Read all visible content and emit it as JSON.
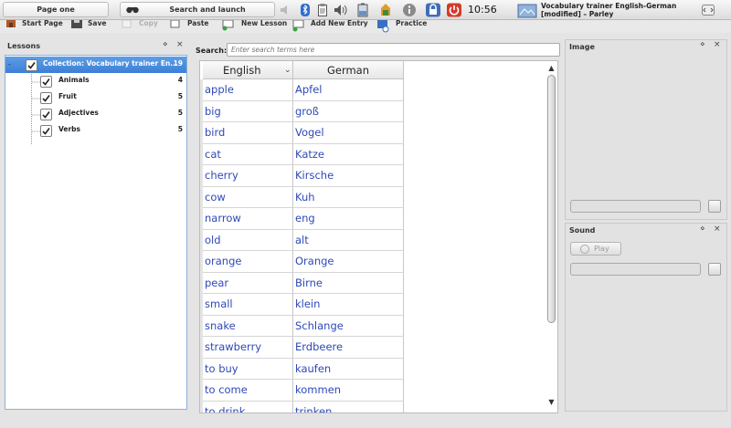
{
  "panel": {
    "pager_label": "Page one",
    "launcher_label": "Search and launch",
    "clock": "10:56 am",
    "window_title": "Vocabulary trainer English-German [modified] – Parley"
  },
  "toolbar": {
    "start_page": "Start Page",
    "save": "Save",
    "copy": "Copy",
    "paste": "Paste",
    "new_lesson": "New Lesson",
    "add_new_entry": "Add New Entry",
    "practice": "Practice"
  },
  "lessons": {
    "title": "Lessons",
    "items": [
      {
        "label": "Collection: Vocabulary trainer En...",
        "count": "19"
      },
      {
        "label": "Animals",
        "count": "4"
      },
      {
        "label": "Fruit",
        "count": "5"
      },
      {
        "label": "Adjectives",
        "count": "5"
      },
      {
        "label": "Verbs",
        "count": "5"
      }
    ]
  },
  "search": {
    "label": "Search:",
    "placeholder": "Enter search terms here"
  },
  "grid": {
    "columns": [
      "English",
      "German"
    ],
    "rows": [
      [
        "apple",
        "Apfel"
      ],
      [
        "big",
        "groß"
      ],
      [
        "bird",
        "Vogel"
      ],
      [
        "cat",
        "Katze"
      ],
      [
        "cherry",
        "Kirsche"
      ],
      [
        "cow",
        "Kuh"
      ],
      [
        "narrow",
        "eng"
      ],
      [
        "old",
        "alt"
      ],
      [
        "orange",
        "Orange"
      ],
      [
        "pear",
        "Birne"
      ],
      [
        "small",
        "klein"
      ],
      [
        "snake",
        "Schlange"
      ],
      [
        "strawberry",
        "Erdbeere"
      ],
      [
        "to buy",
        "kaufen"
      ],
      [
        "to come",
        "kommen"
      ],
      [
        "to drink",
        "trinken"
      ]
    ]
  },
  "image_dock": {
    "title": "Image"
  },
  "sound_dock": {
    "title": "Sound",
    "play_label": "Play"
  },
  "colors": {
    "selection": "#4a8be0",
    "entry_text": "#2e49b8"
  }
}
